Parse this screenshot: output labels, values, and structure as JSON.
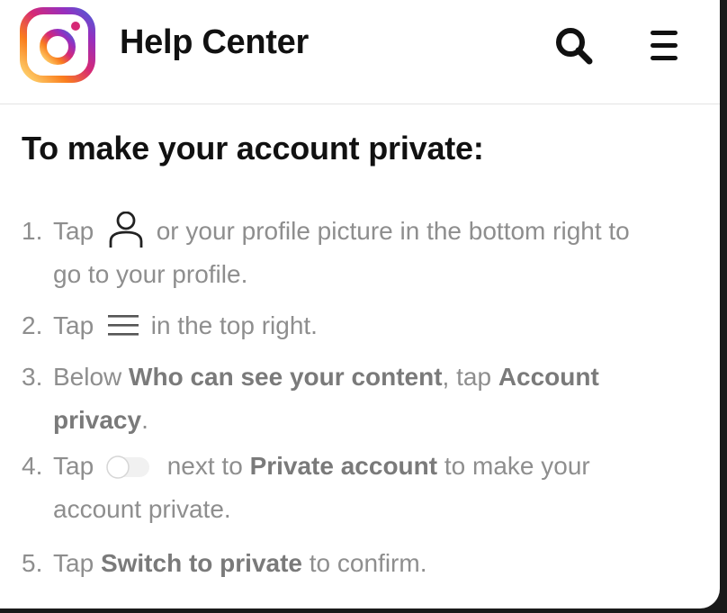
{
  "header": {
    "title": "Help Center",
    "logo_icon": "instagram-logo",
    "search_icon": "search-icon",
    "menu_icon": "hamburger-menu-icon"
  },
  "article": {
    "heading": "To make your account private:",
    "steps": [
      {
        "num": "1.",
        "before": "Tap",
        "icon": "profile-icon",
        "after": "or your profile picture in the bottom right to",
        "cont": "go to your profile."
      },
      {
        "num": "2.",
        "before": "Tap",
        "icon": "hamburger-menu-icon",
        "after": "in the top right."
      },
      {
        "num": "3.",
        "before": "Below",
        "bold1": "Who can see your content",
        "mid": ", tap",
        "bold2": "Account",
        "cont_bold": "privacy",
        "cont_after": "."
      },
      {
        "num": "4.",
        "before": "Tap",
        "icon": "toggle-off-icon",
        "after": "next to",
        "bold": "Private account",
        "after2": "to make your",
        "cont": "account private."
      },
      {
        "num": "5.",
        "before": "Tap",
        "bold": "Switch to private",
        "after": "to confirm."
      }
    ]
  },
  "colors": {
    "text_primary": "#111111",
    "text_secondary": "#8e8e8e",
    "divider": "#e3e3e3",
    "brand_gradient": [
      "#feda75",
      "#fa7e1e",
      "#d62976",
      "#962fbf",
      "#4f5bd5"
    ]
  }
}
